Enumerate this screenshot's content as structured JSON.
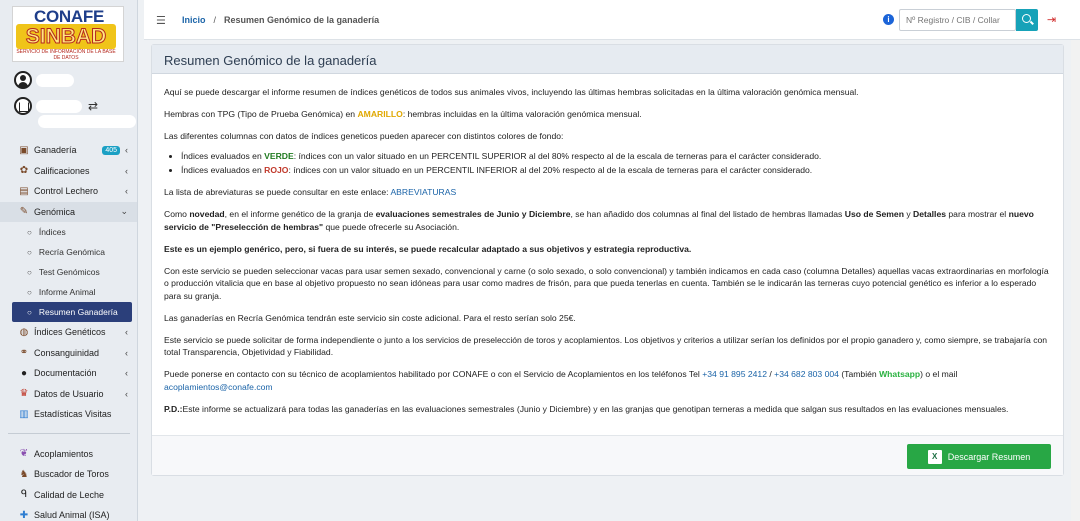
{
  "logo": {
    "line1": "CONAFE",
    "line2": "SINBAD",
    "line3": "SERVICIO DE INFORMACIÓN DE LA BASE DE DATOS"
  },
  "sidebar": {
    "items": [
      {
        "label": "Ganadería",
        "badge": "405",
        "icon": "cow-icon",
        "chevron": "‹"
      },
      {
        "label": "Calificaciones",
        "icon": "ribbon-icon",
        "chevron": "‹"
      },
      {
        "label": "Control Lechero",
        "icon": "milk-icon",
        "chevron": "‹"
      },
      {
        "label": "Genómica",
        "icon": "dna-icon",
        "chevron": "⌄"
      }
    ],
    "subitems": [
      "Índices",
      "Recría Genómica",
      "Test Genómicos",
      "Informe Animal",
      "Resumen Ganadería"
    ],
    "items2": [
      {
        "label": "Índices Genéticos",
        "icon": "bull-icon",
        "chevron": "‹"
      },
      {
        "label": "Consanguinidad",
        "icon": "chain-icon",
        "chevron": "‹"
      },
      {
        "label": "Documentación",
        "icon": "document-icon",
        "chevron": "‹"
      },
      {
        "label": "Datos de Usuario",
        "icon": "user-data-icon",
        "chevron": "‹"
      },
      {
        "label": "Estadísticas Visitas",
        "icon": "stats-icon",
        "chevron": ""
      }
    ],
    "items3": [
      {
        "label": "Acoplamientos",
        "icon": "mating-icon"
      },
      {
        "label": "Buscador de Toros",
        "icon": "search-bull-icon"
      },
      {
        "label": "Calidad de Leche",
        "icon": "milk-quality-icon"
      },
      {
        "label": "Salud Animal (ISA)",
        "icon": "health-icon"
      }
    ]
  },
  "topbar": {
    "home": "Inicio",
    "separator": "/",
    "current": "Resumen Genómico de la ganadería",
    "search_placeholder": "Nº Registro / CIB / Collar"
  },
  "card": {
    "title": "Resumen Genómico de la ganadería",
    "p1": "Aquí se puede descargar el informe resumen de índices genéticos de todos sus animales vivos, incluyendo las últimas hembras solicitadas en la última valoración genómica mensual.",
    "p2a": "Hembras con TPG (Tipo de Prueba Genómica) en ",
    "p2b": "AMARILLO",
    "p2c": ": hembras incluidas en la última valoración genómica mensual.",
    "p3": "Las diferentes columnas con datos de índices geneticos pueden aparecer con distintos colores de fondo:",
    "li1a": "Índices evaluados en ",
    "li1b": "VERDE",
    "li1c": ": índices con un valor situado en un PERCENTIL SUPERIOR al del 80% respecto al de la escala de terneras para el carácter considerado.",
    "li2a": "Índices evaluados en ",
    "li2b": "ROJO",
    "li2c": ": índices con un valor situado en un PERCENTIL INFERIOR al del 20% respecto al de la escala de terneras para el carácter considerado.",
    "p4a": "La lista de abreviaturas se puede consultar en este enlace: ",
    "p4b": "ABREVIATURAS",
    "p5a": "Como ",
    "p5b": "novedad",
    "p5c": ", en el informe genético de la granja de ",
    "p5d": "evaluaciones semestrales de Junio y Diciembre",
    "p5e": ", se han añadido dos columnas al final del listado de hembras llamadas ",
    "p5f": "Uso de Semen",
    "p5g": " y ",
    "p5h": "Detalles",
    "p5i": " para mostrar el ",
    "p5j": "nuevo servicio de \"Preselección de hembras\"",
    "p5k": " que puede ofrecerle su Asociación.",
    "p6": "Este es un ejemplo genérico, pero, si fuera de su interés, se puede recalcular adaptado a sus objetivos y estrategia reproductiva.",
    "p7": "Con este servicio se pueden seleccionar vacas para usar semen sexado, convencional y carne (o solo sexado, o solo convencional) y también indicamos en cada caso (columna Detalles) aquellas vacas extraordinarias en morfología o producción vitalicia que en base al objetivo propuesto no sean idóneas para usar como madres de frisón, para que pueda tenerlas en cuenta. También se le indicarán las terneras cuyo potencial genético es inferior a lo esperado para su granja.",
    "p8": "Las ganaderías en Recría Genómica tendrán este servicio sin coste adicional. Para el resto serían solo 25€.",
    "p9": "Este servicio se puede solicitar de forma independiente o junto a los servicios de preselección de toros y acoplamientos. Los objetivos y criterios a utilizar serían los definidos por el propio ganadero y, como siempre, se trabajaría con total Transparencia, Objetividad y Fiabilidad.",
    "p10a": "Puede ponerse en contacto con su técnico de acoplamientos habilitado por CONAFE o con el Servicio de Acoplamientos en los teléfonos Tel ",
    "p10b": "+34 91 895 2412",
    "p10c": " / ",
    "p10d": "+34 682 803 004",
    "p10e": " (También ",
    "p10f": "Whatsapp",
    "p10g": ") o el mail ",
    "p10h": "acoplamientos@conafe.com",
    "p11a": "P.D.:",
    "p11b": "Este informe se actualizará para todas las ganaderías en las evaluaciones semestrales (Junio y Diciembre) y en las granjas que genotipan terneras a medida que salgan sus resultados en las evaluaciones mensuales.",
    "download_label": "Descargar Resumen"
  }
}
